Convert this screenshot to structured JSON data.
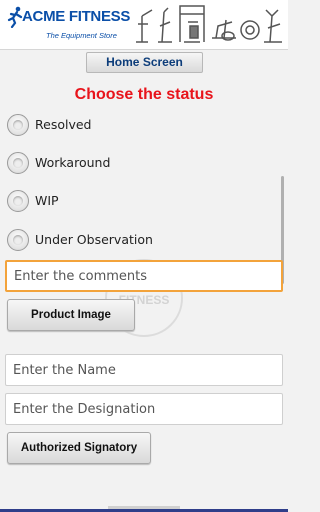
{
  "header": {
    "brand": "ACME FITNESS",
    "tagline": "The Equipment Store",
    "logo_icon": "running-man-logo-icon",
    "equipment_icon": "gym-equipment-banner-icon",
    "brand_color": "#0b4fa8"
  },
  "nav": {
    "home_label": "Home Screen"
  },
  "form": {
    "title": "Choose the status",
    "title_color": "#e8141b",
    "status_options": [
      {
        "label": "Resolved",
        "selected": false
      },
      {
        "label": "Workaround",
        "selected": false
      },
      {
        "label": "WIP",
        "selected": false
      },
      {
        "label": "Under Observation",
        "selected": false
      }
    ],
    "comments": {
      "value": "",
      "placeholder": "Enter the comments",
      "focused": true
    },
    "product_image_label": "Product Image",
    "name": {
      "value": "",
      "placeholder": "Enter the Name"
    },
    "designation": {
      "value": "",
      "placeholder": "Enter the Designation"
    },
    "signatory_label": "Authorized Signatory"
  },
  "watermark": {
    "text": "FITNESS",
    "icon": "acme-watermark-icon"
  }
}
